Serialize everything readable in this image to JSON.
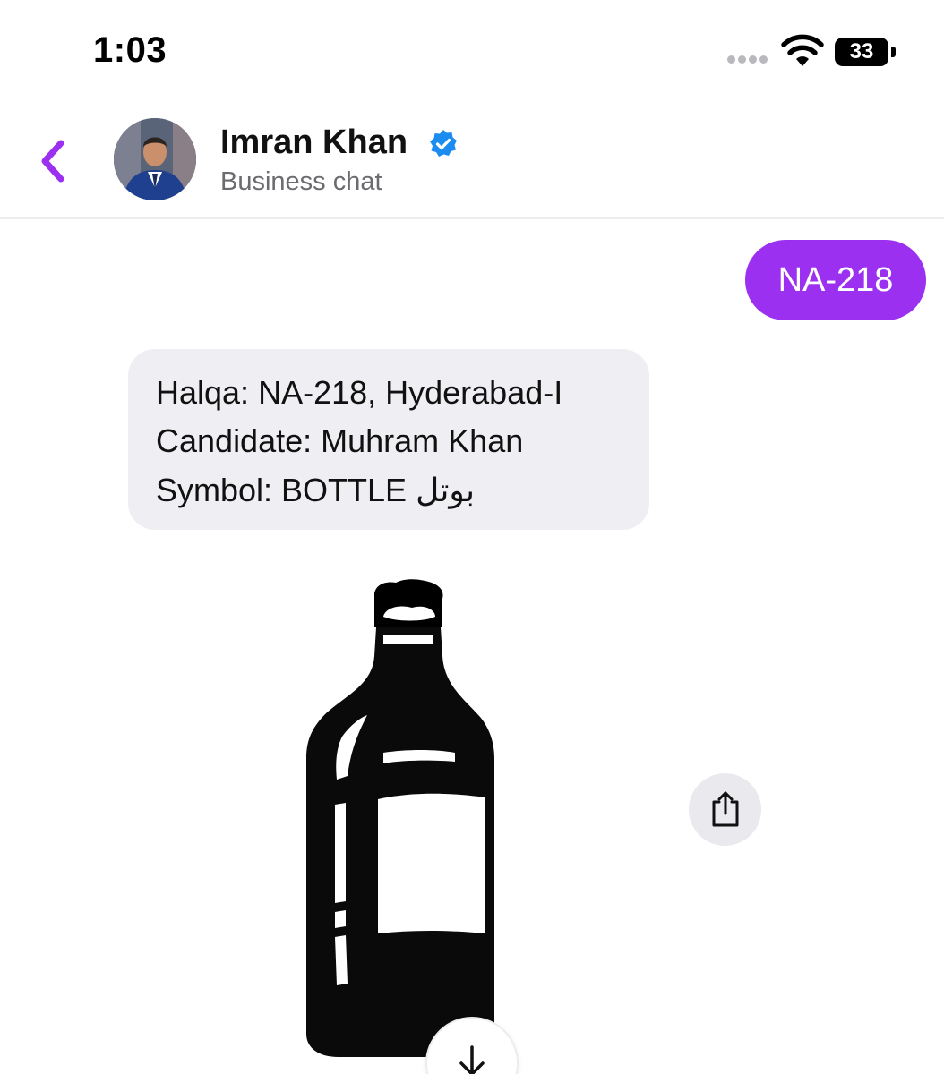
{
  "status_bar": {
    "time": "1:03",
    "battery": "33"
  },
  "header": {
    "name": "Imran Khan",
    "subtitle": "Business chat",
    "icons": [
      "back-chevron-icon",
      "verified-badge-icon"
    ]
  },
  "messages": {
    "outgoing": {
      "text": "NA-218"
    },
    "incoming": {
      "line1": "Halqa: NA-218, Hyderabad-I",
      "line2": "Candidate: Muhram Khan",
      "line3": "Symbol: BOTTLE بوتل"
    },
    "image": {
      "subject": "bottle-symbol"
    }
  },
  "actions": {
    "icons": [
      "share-icon",
      "download-arrow-icon"
    ]
  },
  "colors": {
    "accent": "#9b30f0",
    "incoming_bubble": "#efeff3",
    "verified": "#1d8cf0",
    "subtitle_text": "#6b6b70"
  }
}
